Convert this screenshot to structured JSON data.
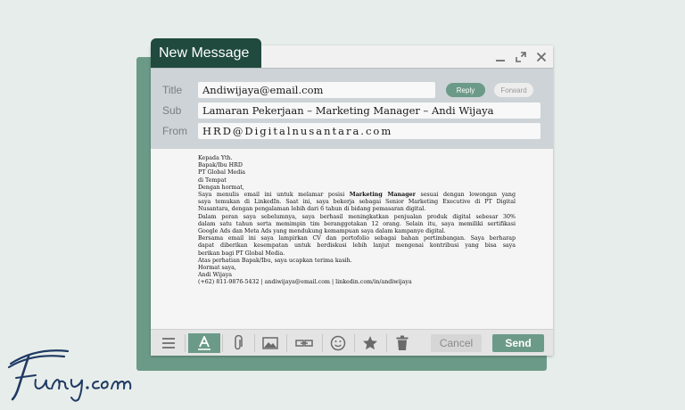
{
  "window": {
    "title": "New Message"
  },
  "header": {
    "to_label": "Title",
    "to_value": "Andiwijaya@email.com",
    "subject_label": "Sub",
    "subject_value": "Lamaran Pekerjaan – Marketing Manager – Andi Wijaya",
    "from_label": "From",
    "from_value": "HRD@Digitalnusantara.com",
    "reply_label": "Reply",
    "forward_label": "Forward"
  },
  "letter": {
    "greeting_1": "Kepada Yth.",
    "greeting_2": "Bapak/Ibu  HRD",
    "greeting_3": "PT Global  Media",
    "greeting_4": "di Tempat",
    "salutation": "Dengan  hormat,",
    "p1_a": "Saya menulis email ini untuk melamar posisi ",
    "p1_position": "Marketing Manager",
    "p1_b": " sesuai dengan lowongan yang",
    "p1_l2": "saya temukan di LinkedIn. Saat ini, saya bekerja sebagai Senior Marketing Executive di PT Digital",
    "p1_l3": "Nusantara,  dengan  pengalaman  lebih dari 6 tahun  di bidang  pemasaran  digital.",
    "p2_l1": "Dalam peran saya sebelumnya, saya berhasil meningkatkan penjualan produk digital sebesar 30%",
    "p2_l2": "dalam satu tahun serta memimpin tim beranggotakan 12 orang. Selain itu, saya memiliki sertifikasi",
    "p2_l3": "Google Ads dan Meta Ads yang mendukung  kemampuan  saya dalam  kampanye  digital.",
    "p3_l1": "Bersama email ini saya lampirkan CV dan portofolio sebagai bahan pertimbangan. Saya berharap",
    "p3_l2": "dapat diberikan  kesempatan  untuk berdiskusi lebih lanjut  mengenai kontribusi yang bisa saya",
    "p3_l3": "berikan  bagi PT Global Media.",
    "closing_1": "Atas perhatian  Bapak/Ibu,  saya ucapkan  terima  kasih.",
    "closing_2": "Hormat  saya,",
    "signature": "Andi  Wijaya",
    "contact": "(+62)  811-9876-5432   |  andiwijaya@email.com   |  linkedin.com/in/andiwijaya"
  },
  "toolbar": {
    "cancel_label": "Cancel",
    "send_label": "Send"
  },
  "icons": [
    "menu-icon",
    "text-format-icon",
    "attachment-icon",
    "image-icon",
    "link-icon",
    "emoji-icon",
    "star-icon",
    "trash-icon",
    "minimize-icon",
    "maximize-icon",
    "close-icon"
  ],
  "colors": {
    "accent": "#6c9a89",
    "title_tab": "#1f4a3d",
    "header_bg": "#cdd3d6"
  }
}
